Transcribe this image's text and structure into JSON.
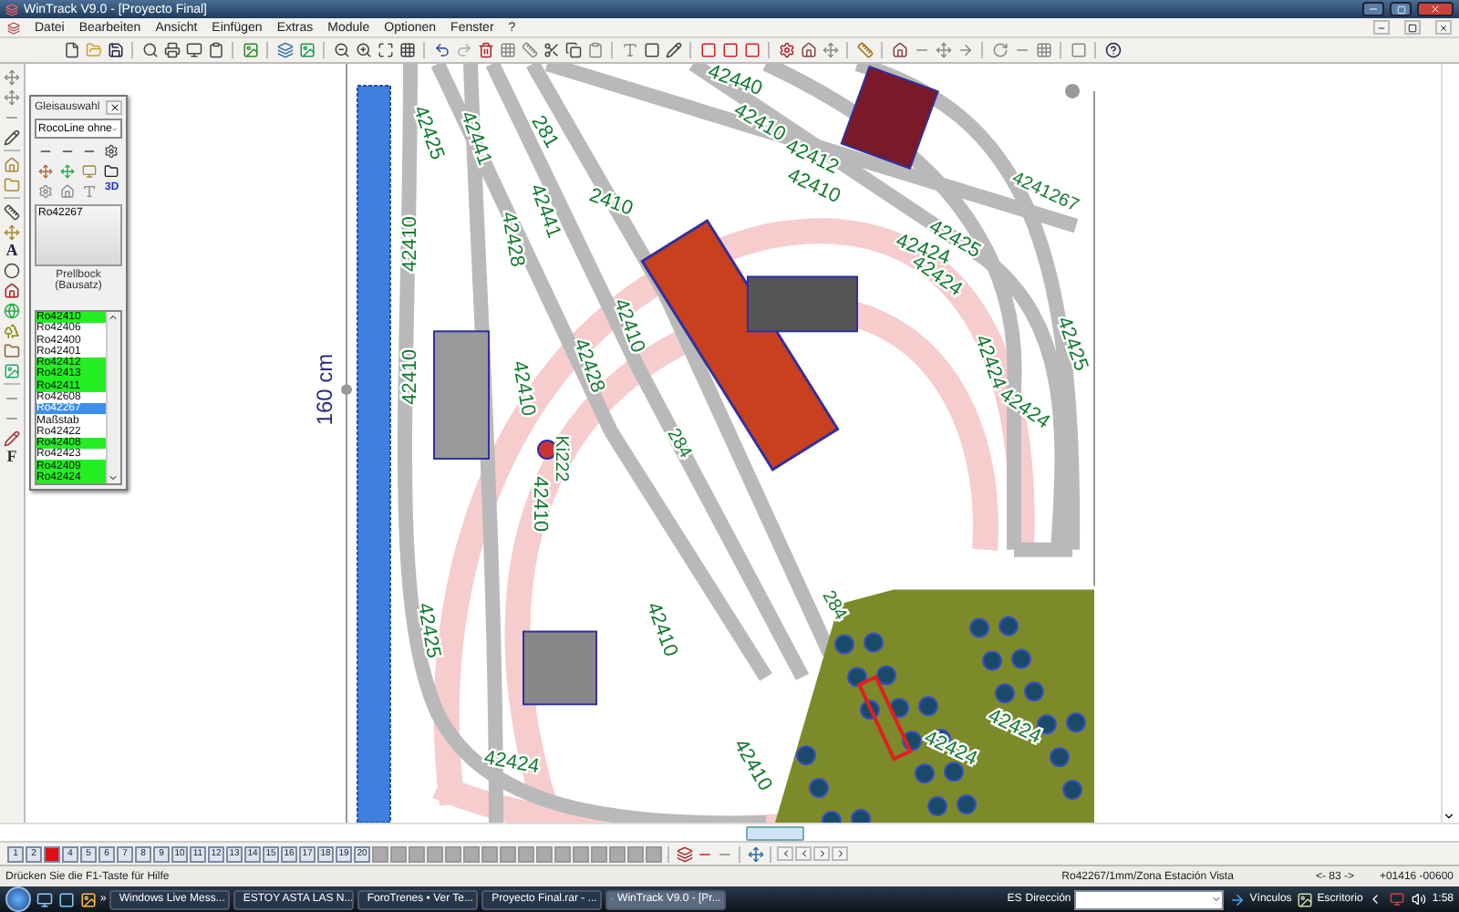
{
  "window": {
    "title": "WinTrack  V9.0 - [Proyecto Final]"
  },
  "menu": [
    "Datei",
    "Bearbeiten",
    "Ansicht",
    "Einfügen",
    "Extras",
    "Module",
    "Optionen",
    "Fenster",
    "?"
  ],
  "left_toolbar_letters": [
    "A",
    "F"
  ],
  "canvas": {
    "dimension_label": "160 cm",
    "track_numbers": [
      "42425",
      "42441",
      "281",
      "42440",
      "42410",
      "42412",
      "4241267",
      "42410",
      "42425",
      "42424",
      "42424",
      "42441",
      "42428",
      "42410",
      "2410",
      "42424",
      "42425",
      "42424",
      "42410",
      "42428",
      "42410",
      "42410",
      "Ki222",
      "42410",
      "42424",
      "42424",
      "42425",
      "42410",
      "284",
      "284",
      "42424",
      "42410"
    ]
  },
  "track_panel": {
    "title": "Gleisauswahl",
    "system": "RocoLine ohne",
    "icon_label": "3D",
    "preview_code": "Ro42267",
    "preview_caption": "Prellbock (Bausatz)",
    "items": [
      {
        "label": "Ro42410",
        "used": true,
        "selected": false
      },
      {
        "label": "Ro42406",
        "used": false,
        "selected": false
      },
      {
        "label": "Ro42400",
        "used": false,
        "selected": false
      },
      {
        "label": "Ro42401",
        "used": false,
        "selected": false
      },
      {
        "label": "Ro42412",
        "used": true,
        "selected": false
      },
      {
        "label": "Ro42413",
        "used": true,
        "selected": false
      },
      {
        "label": "Ro42411",
        "used": true,
        "selected": false
      },
      {
        "label": "Ro42608",
        "used": false,
        "selected": false
      },
      {
        "label": "Ro42267",
        "used": false,
        "selected": true
      },
      {
        "label": "Maßstab",
        "used": false,
        "selected": false
      },
      {
        "label": "Ro42422",
        "used": false,
        "selected": false
      },
      {
        "label": "Ro42408",
        "used": true,
        "selected": false
      },
      {
        "label": "Ro42423",
        "used": false,
        "selected": false
      },
      {
        "label": "Ro42409",
        "used": true,
        "selected": false
      },
      {
        "label": "Ro42424",
        "used": true,
        "selected": false
      }
    ]
  },
  "layers": [
    {
      "label": "1",
      "selected": false
    },
    {
      "label": "2",
      "selected": false
    },
    {
      "selected": true
    },
    {
      "label": "4",
      "selected": false
    },
    {
      "label": "5",
      "selected": false
    },
    {
      "label": "6",
      "selected": false
    },
    {
      "label": "7",
      "selected": false
    },
    {
      "label": "8",
      "selected": false
    },
    {
      "label": "9",
      "selected": false
    },
    {
      "label": "10",
      "selected": false
    },
    {
      "label": "11",
      "selected": false
    },
    {
      "label": "12",
      "selected": false
    },
    {
      "label": "13",
      "selected": false
    },
    {
      "label": "14",
      "selected": false
    },
    {
      "label": "15",
      "selected": false
    },
    {
      "label": "16",
      "selected": false
    },
    {
      "label": "17",
      "selected": false
    },
    {
      "label": "18",
      "selected": false
    },
    {
      "label": "19",
      "selected": false
    },
    {
      "label": "20",
      "selected": false
    }
  ],
  "status_bar": {
    "hint": "Drücken Sie die  F1-Taste für Hilfe",
    "element": "Ro42267/1mm/Zona Estación Vista",
    "page": "<- 83 ->",
    "coordinates": "+01416  -00600"
  },
  "taskbar": {
    "tasks": [
      {
        "label": "Windows Live Mess...",
        "selected": false
      },
      {
        "label": "ESTOY ASTA LAS N...",
        "selected": false
      },
      {
        "label": "ForoTrenes • Ver Te...",
        "selected": false
      },
      {
        "label": "Proyecto Final.rar - ...",
        "selected": false
      },
      {
        "label": "WinTrack  V9.0 - [Pr...",
        "selected": true
      }
    ],
    "language": "ES",
    "address_label": "Dirección",
    "links": "Vínculos",
    "desktop": "Escritorio",
    "overflow": "»",
    "clock": "1:58"
  }
}
